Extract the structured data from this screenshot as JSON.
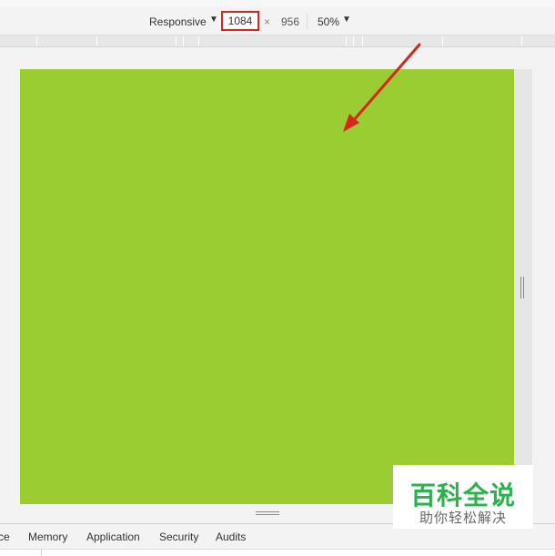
{
  "device_toolbar": {
    "mode": "Responsive",
    "mode_arrow": "▼",
    "width": "1084",
    "separator": "×",
    "height": "956",
    "zoom": "50%",
    "zoom_arrow": "▼"
  },
  "device_screen": {
    "background": "#9acd31"
  },
  "annotation": {
    "color": "#d9261c"
  },
  "devtools_tabs": [
    "ce",
    "Memory",
    "Application",
    "Security",
    "Audits"
  ],
  "watermark": {
    "title": "百科全说",
    "subtitle": "助你轻松解决"
  }
}
